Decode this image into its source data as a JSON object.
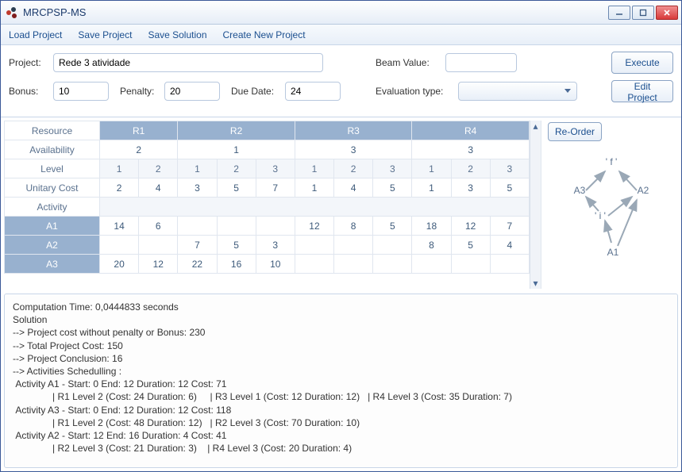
{
  "titlebar": {
    "title": "MRCPSP-MS"
  },
  "menu": {
    "load_project": "Load Project",
    "save_project": "Save Project",
    "save_solution": "Save Solution",
    "create_new": "Create New Project"
  },
  "labels": {
    "project": "Project:",
    "bonus": "Bonus:",
    "penalty": "Penalty:",
    "due_date": "Due Date:",
    "beam_value": "Beam Value:",
    "eval_type": "Evaluation type:"
  },
  "buttons": {
    "execute": "Execute",
    "edit_project": "Edit Project",
    "reorder": "Re-Order"
  },
  "form": {
    "project_name": "Rede 3 atividade",
    "bonus": "10",
    "penalty": "20",
    "due_date": "24",
    "beam_value": "",
    "eval_type": ""
  },
  "table": {
    "row_labels": {
      "resource": "Resource",
      "availability": "Availability",
      "level": "Level",
      "unitary_cost": "Unitary Cost",
      "activity": "Activity",
      "a1": "A1",
      "a2": "A2",
      "a3": "A3"
    },
    "resources": [
      "R1",
      "R2",
      "R3",
      "R4"
    ],
    "availability": [
      "2",
      "1",
      "3",
      "3"
    ],
    "levels": [
      "1",
      "2",
      "1",
      "2",
      "3",
      "1",
      "2",
      "3",
      "1",
      "2",
      "3"
    ],
    "unitary_cost": [
      "2",
      "4",
      "3",
      "5",
      "7",
      "1",
      "4",
      "5",
      "1",
      "3",
      "5"
    ],
    "a1": [
      "14",
      "6",
      "",
      "",
      "",
      "12",
      "8",
      "5",
      "18",
      "12",
      "7"
    ],
    "a2": [
      "",
      "",
      "7",
      "5",
      "3",
      "",
      "",
      "",
      "8",
      "5",
      "4"
    ],
    "a3": [
      "20",
      "12",
      "22",
      "16",
      "10",
      "",
      "",
      "",
      "",
      "",
      ""
    ]
  },
  "graph": {
    "node_top": "' f '",
    "node_left": "A3",
    "node_right": "A2",
    "node_mid": "' i '",
    "node_bottom": "A1"
  },
  "output": "Computation Time: 0,0444833 seconds\nSolution\n--> Project cost without penalty or Bonus: 230\n--> Total Project Cost: 150\n--> Project Conclusion: 16\n--> Activities Schedulling :\n Activity A1 - Start: 0 End: 12 Duration: 12 Cost: 71\n               | R1 Level 2 (Cost: 24 Duration: 6)     | R3 Level 1 (Cost: 12 Duration: 12)   | R4 Level 3 (Cost: 35 Duration: 7)\n Activity A3 - Start: 0 End: 12 Duration: 12 Cost: 118\n               | R1 Level 2 (Cost: 48 Duration: 12)   | R2 Level 3 (Cost: 70 Duration: 10)\n Activity A2 - Start: 12 End: 16 Duration: 4 Cost: 41\n               | R2 Level 3 (Cost: 21 Duration: 3)    | R4 Level 3 (Cost: 20 Duration: 4)"
}
